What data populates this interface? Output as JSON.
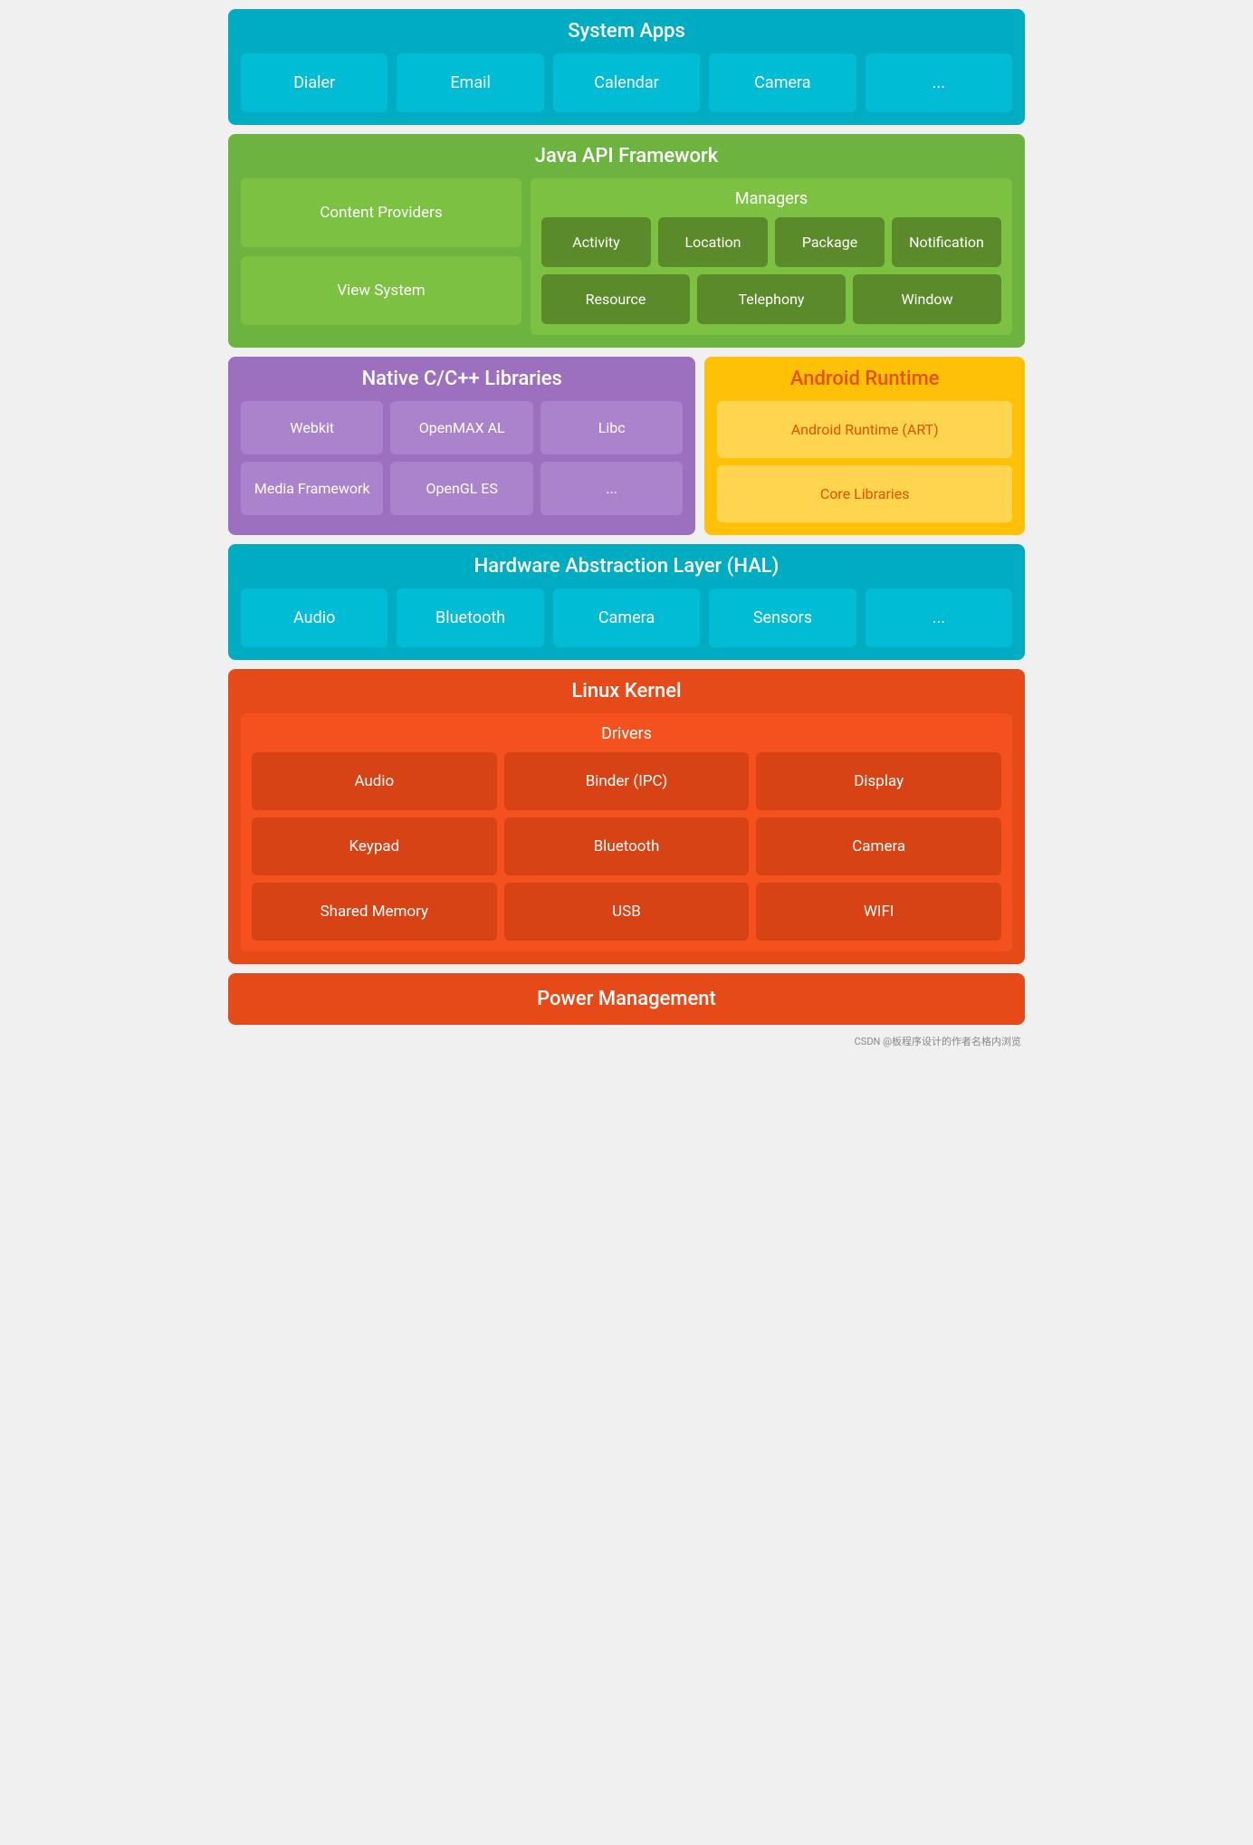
{
  "systemApps": {
    "title": "System Apps",
    "items": [
      "Dialer",
      "Email",
      "Calendar",
      "Camera",
      "..."
    ]
  },
  "javaApi": {
    "title": "Java API Framework",
    "left": [
      "Content Providers",
      "View System"
    ],
    "managers": {
      "title": "Managers",
      "row1": [
        "Activity",
        "Location",
        "Package",
        "Notification"
      ],
      "row2": [
        "Resource",
        "Telephony",
        "Window"
      ]
    }
  },
  "nativeLibs": {
    "title": "Native C/C++ Libraries",
    "row1": [
      "Webkit",
      "OpenMAX AL",
      "Libc"
    ],
    "row2": [
      "Media Framework",
      "OpenGL ES",
      "..."
    ]
  },
  "androidRuntime": {
    "title": "Android Runtime",
    "items": [
      "Android Runtime (ART)",
      "Core Libraries"
    ]
  },
  "hal": {
    "title": "Hardware Abstraction Layer (HAL)",
    "items": [
      "Audio",
      "Bluetooth",
      "Camera",
      "Sensors",
      "..."
    ]
  },
  "kernel": {
    "title": "Linux Kernel",
    "drivers": {
      "title": "Drivers",
      "row1": [
        "Audio",
        "Binder (IPC)",
        "Display"
      ],
      "row2": [
        "Keypad",
        "Bluetooth",
        "Camera"
      ],
      "row3": [
        "Shared Memory",
        "USB",
        "WIFI"
      ]
    }
  },
  "powerManagement": {
    "title": "Power Management"
  },
  "watermark": "CSDN @板程序设计的作者名格内浏览"
}
